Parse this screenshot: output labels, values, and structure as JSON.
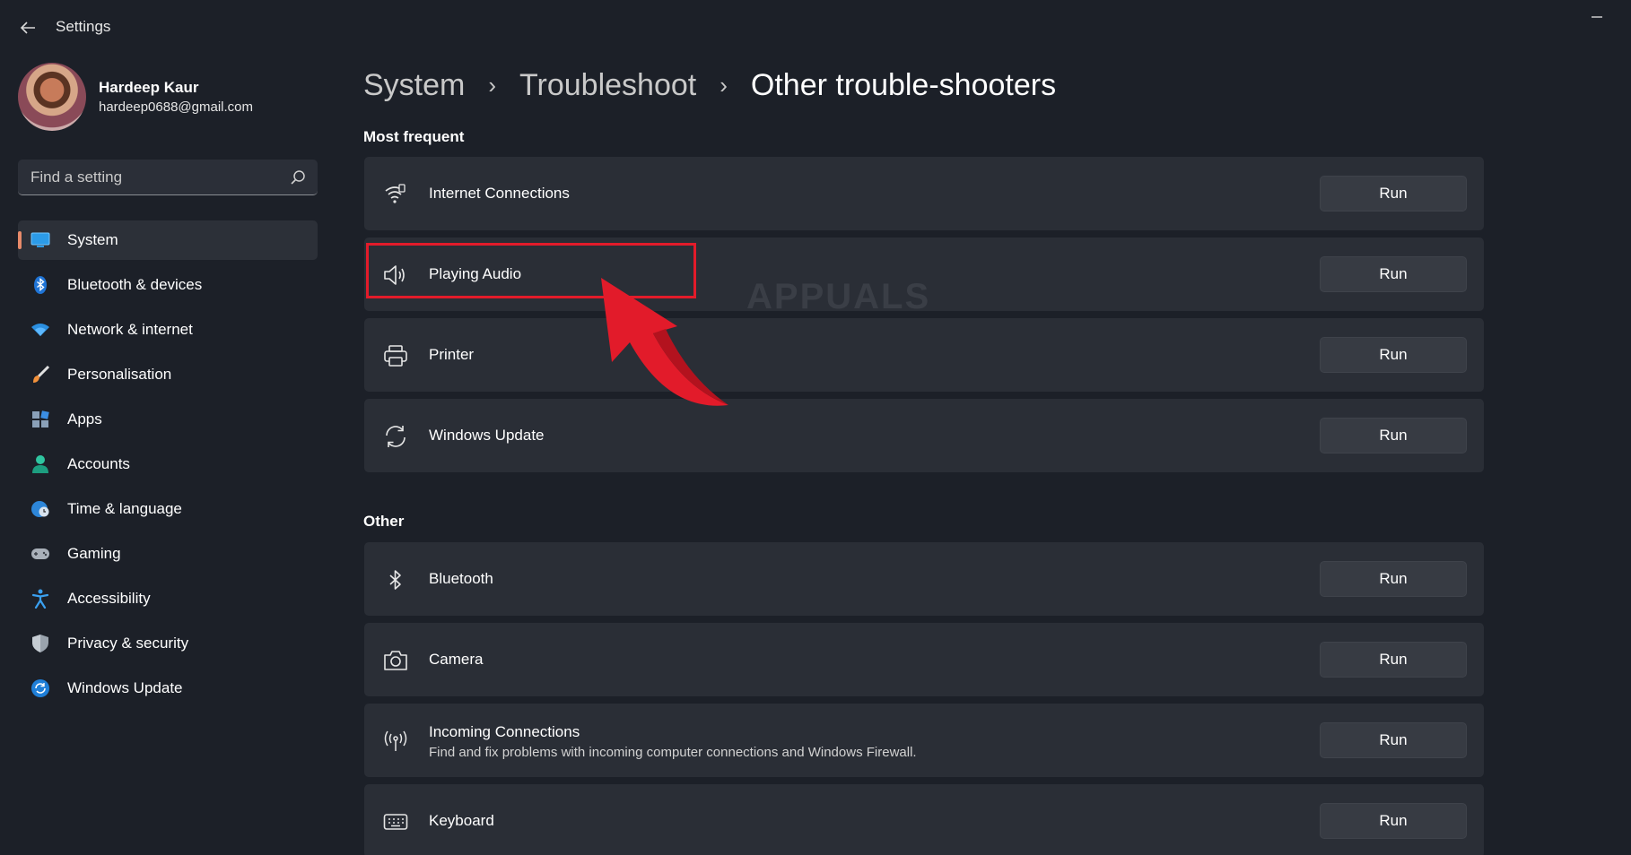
{
  "window": {
    "title": "Settings"
  },
  "profile": {
    "name": "Hardeep Kaur",
    "email": "hardeep0688@gmail.com"
  },
  "search": {
    "placeholder": "Find a setting"
  },
  "nav": {
    "items": [
      {
        "label": "System",
        "icon": "system-icon",
        "active": true
      },
      {
        "label": "Bluetooth & devices",
        "icon": "bluetooth-icon"
      },
      {
        "label": "Network & internet",
        "icon": "wifi-icon"
      },
      {
        "label": "Personalisation",
        "icon": "brush-icon"
      },
      {
        "label": "Apps",
        "icon": "apps-icon"
      },
      {
        "label": "Accounts",
        "icon": "account-icon"
      },
      {
        "label": "Time & language",
        "icon": "globe-clock-icon"
      },
      {
        "label": "Gaming",
        "icon": "gamepad-icon"
      },
      {
        "label": "Accessibility",
        "icon": "accessibility-icon"
      },
      {
        "label": "Privacy & security",
        "icon": "shield-icon"
      },
      {
        "label": "Windows Update",
        "icon": "update-icon"
      }
    ]
  },
  "breadcrumb": {
    "level1": "System",
    "level2": "Troubleshoot",
    "current": "Other trouble-shooters",
    "separator": "›"
  },
  "sections": {
    "most_frequent": {
      "title": "Most frequent",
      "items": [
        {
          "label": "Internet Connections",
          "icon": "internet-connections-icon",
          "button": "Run"
        },
        {
          "label": "Playing Audio",
          "icon": "speaker-icon",
          "button": "Run"
        },
        {
          "label": "Printer",
          "icon": "printer-icon",
          "button": "Run"
        },
        {
          "label": "Windows Update",
          "icon": "sync-icon",
          "button": "Run"
        }
      ]
    },
    "other": {
      "title": "Other",
      "items": [
        {
          "label": "Bluetooth",
          "icon": "bluetooth-icon",
          "button": "Run"
        },
        {
          "label": "Camera",
          "icon": "camera-icon",
          "button": "Run"
        },
        {
          "label": "Incoming Connections",
          "description": "Find and fix problems with incoming computer connections and Windows Firewall.",
          "icon": "antenna-icon",
          "button": "Run"
        },
        {
          "label": "Keyboard",
          "icon": "keyboard-icon",
          "button": "Run"
        }
      ]
    }
  },
  "watermark": {
    "text": "APPUALS"
  },
  "colors": {
    "highlight": "#e21b2a",
    "accent": "#e88a6a",
    "background": "#1c2028",
    "card": "#2a2e36"
  }
}
